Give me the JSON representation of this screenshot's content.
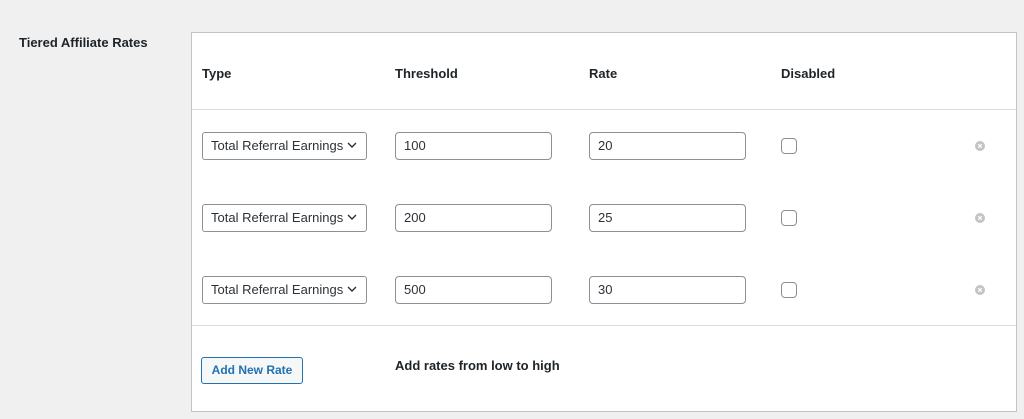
{
  "section": {
    "label": "Tiered Affiliate Rates"
  },
  "table": {
    "headers": [
      "Type",
      "Threshold",
      "Rate",
      "Disabled"
    ],
    "rows": [
      {
        "type": "Total Referral Earnings",
        "threshold": "100",
        "rate": "20",
        "disabled": false
      },
      {
        "type": "Total Referral Earnings",
        "threshold": "200",
        "rate": "25",
        "disabled": false
      },
      {
        "type": "Total Referral Earnings",
        "threshold": "500",
        "rate": "30",
        "disabled": false
      }
    ]
  },
  "footer": {
    "add_button_label": "Add New Rate",
    "hint": "Add rates from low to high"
  },
  "colors": {
    "accent": "#2271b1",
    "border": "#8c8f94",
    "background": "#f0f0f1"
  },
  "icons": {
    "select_caret": "chevron-down-icon",
    "remove_row": "remove-circle-icon"
  }
}
